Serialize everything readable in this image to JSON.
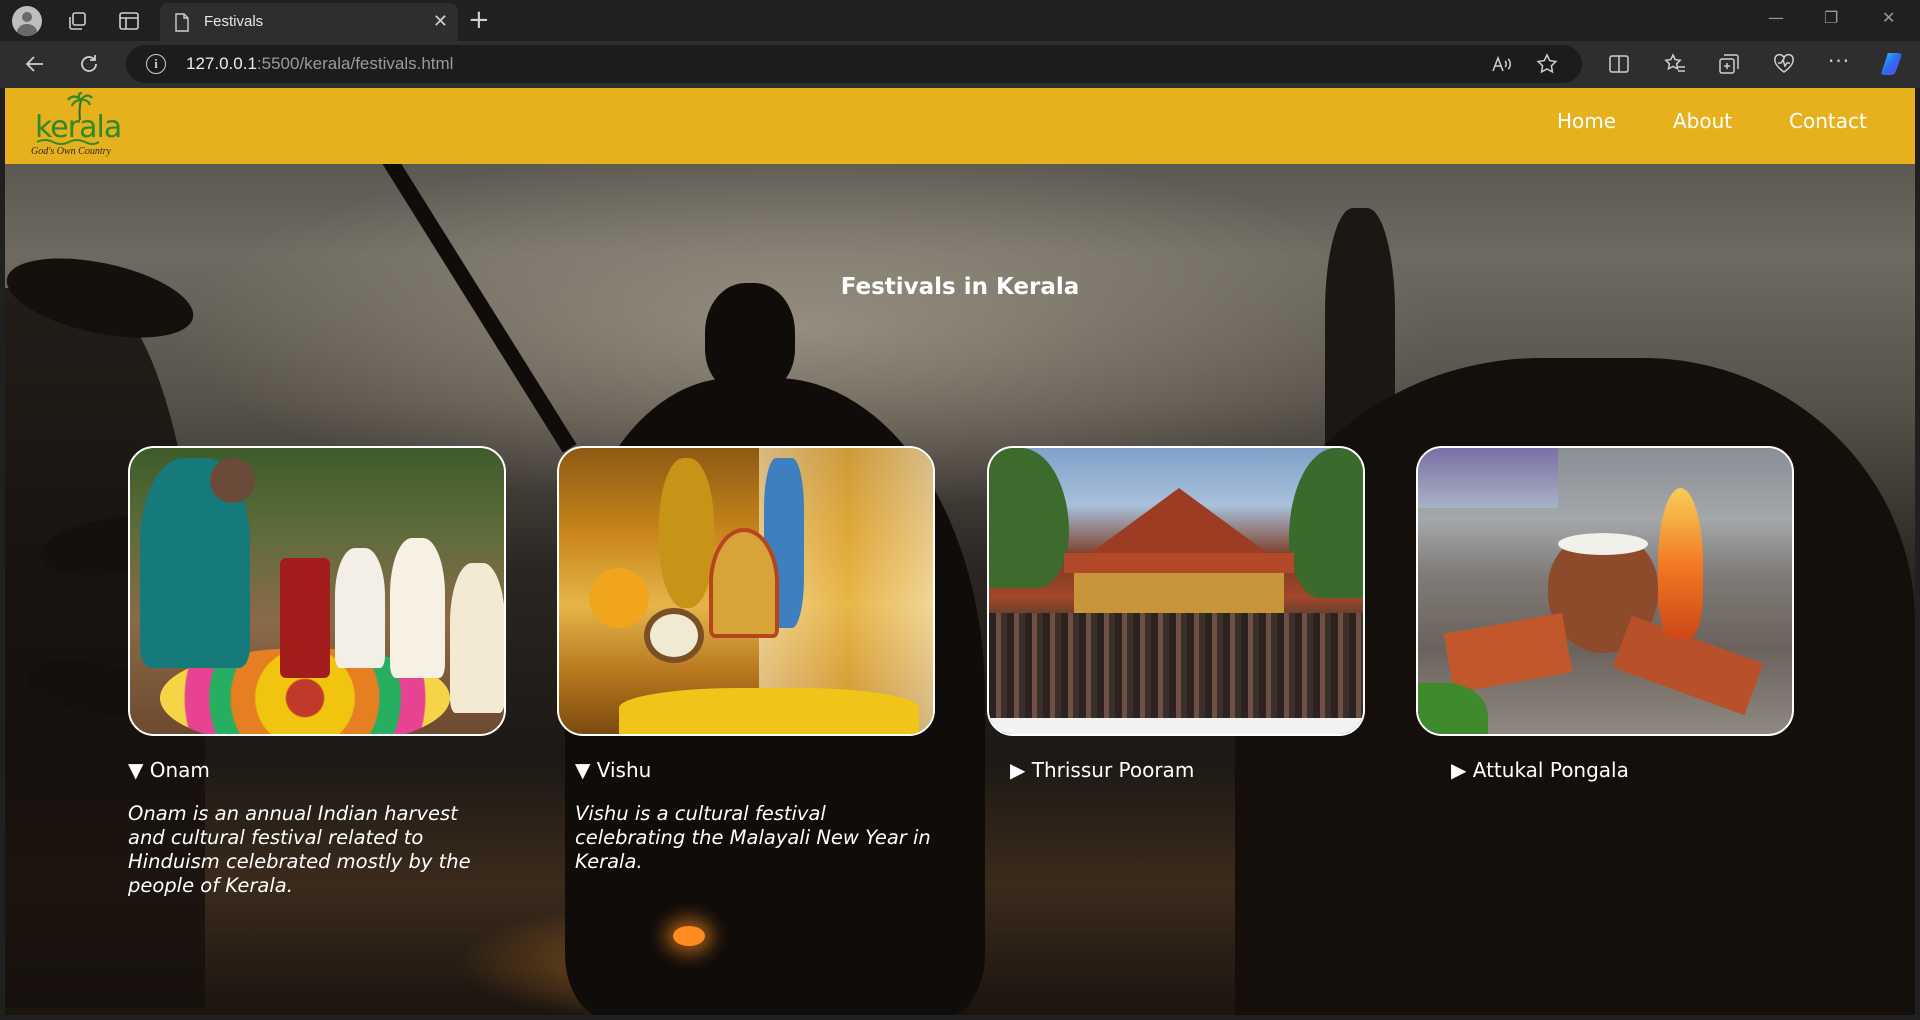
{
  "browser": {
    "tab_title": "Festivals",
    "url_host": "127.0.0.1",
    "url_path": ":5500/kerala/festivals.html"
  },
  "site": {
    "logo_text": "kerala",
    "logo_tagline": "God's Own Country",
    "nav": [
      "Home",
      "About",
      "Contact"
    ],
    "title": "Festivals in Kerala",
    "colors": {
      "navbar": "#e7b01d",
      "text": "#ffffff"
    }
  },
  "festivals": [
    {
      "name": "Onam",
      "open": true,
      "marker": "▼",
      "description": "Onam is an annual Indian harvest and cultural festival related to Hinduism celebrated mostly by the people of Kerala."
    },
    {
      "name": "Vishu",
      "open": true,
      "marker": "▼",
      "description": "Vishu is a cultural festival celebrating the Malayali New Year in Kerala."
    },
    {
      "name": "Thrissur Pooram",
      "open": false,
      "marker": "▶",
      "description": ""
    },
    {
      "name": "Attukal Pongala",
      "open": false,
      "marker": "▶",
      "description": ""
    }
  ]
}
